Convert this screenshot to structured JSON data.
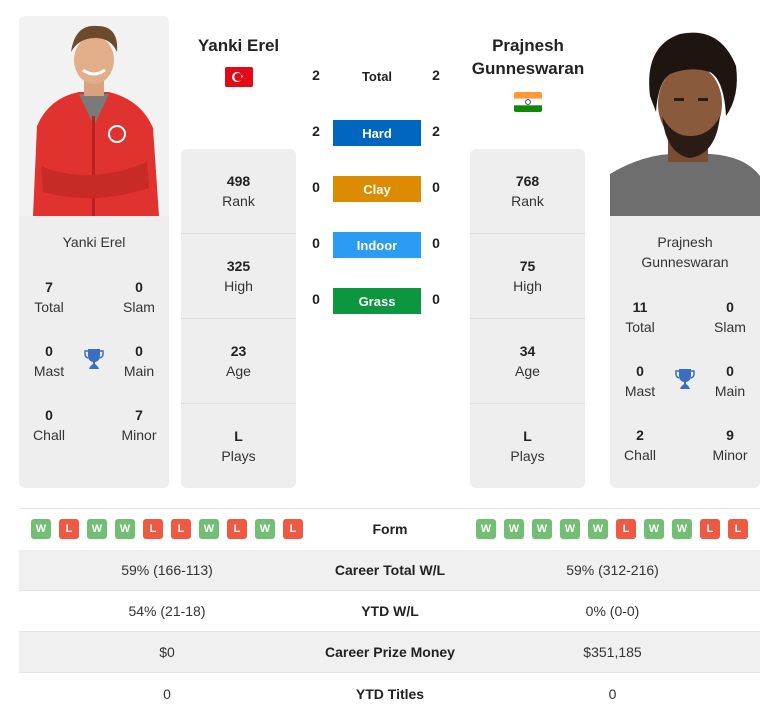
{
  "player1": {
    "name": "Yanki Erel",
    "flag": "turkey-flag",
    "card_name": "Yanki Erel",
    "titles": {
      "total": {
        "value": "7",
        "label": "Total"
      },
      "slam": {
        "value": "0",
        "label": "Slam"
      },
      "mast": {
        "value": "0",
        "label": "Mast"
      },
      "main": {
        "value": "0",
        "label": "Main"
      },
      "chall": {
        "value": "0",
        "label": "Chall"
      },
      "minor": {
        "value": "7",
        "label": "Minor"
      }
    },
    "stats": [
      {
        "value": "498",
        "label": "Rank"
      },
      {
        "value": "325",
        "label": "High"
      },
      {
        "value": "23",
        "label": "Age"
      },
      {
        "value": "L",
        "label": "Plays"
      }
    ],
    "form": [
      "W",
      "L",
      "W",
      "W",
      "L",
      "L",
      "W",
      "L",
      "W",
      "L"
    ]
  },
  "player2": {
    "name_line1": "Prajnesh",
    "name_line2": "Gunneswaran",
    "flag": "india-flag",
    "card_name_line1": "Prajnesh",
    "card_name_line2": "Gunneswaran",
    "titles": {
      "total": {
        "value": "11",
        "label": "Total"
      },
      "slam": {
        "value": "0",
        "label": "Slam"
      },
      "mast": {
        "value": "0",
        "label": "Mast"
      },
      "main": {
        "value": "0",
        "label": "Main"
      },
      "chall": {
        "value": "2",
        "label": "Chall"
      },
      "minor": {
        "value": "9",
        "label": "Minor"
      }
    },
    "stats": [
      {
        "value": "768",
        "label": "Rank"
      },
      {
        "value": "75",
        "label": "High"
      },
      {
        "value": "34",
        "label": "Age"
      },
      {
        "value": "L",
        "label": "Plays"
      }
    ],
    "form": [
      "W",
      "W",
      "W",
      "W",
      "W",
      "L",
      "W",
      "W",
      "L",
      "L"
    ]
  },
  "h2h": {
    "total": {
      "label": "Total",
      "p1": "2",
      "p2": "2"
    },
    "surfaces": [
      {
        "label": "Hard",
        "p1": "2",
        "p2": "2",
        "color": "#0066c0"
      },
      {
        "label": "Clay",
        "p1": "0",
        "p2": "0",
        "color": "#dd8c00"
      },
      {
        "label": "Indoor",
        "p1": "0",
        "p2": "0",
        "color": "#2a9cf4"
      },
      {
        "label": "Grass",
        "p1": "0",
        "p2": "0",
        "color": "#0c9640"
      }
    ]
  },
  "form_label": "Form",
  "comparison": [
    {
      "label": "Career Total W/L",
      "p1": "59% (166-113)",
      "p2": "59% (312-216)"
    },
    {
      "label": "YTD W/L",
      "p1": "54% (21-18)",
      "p2": "0% (0-0)"
    },
    {
      "label": "Career Prize Money",
      "p1": "$0",
      "p2": "$351,185"
    },
    {
      "label": "YTD Titles",
      "p1": "0",
      "p2": "0"
    }
  ],
  "colors": {
    "win": "#72bf73",
    "loss": "#ee5a41",
    "trophy": "#3a6fc0"
  }
}
